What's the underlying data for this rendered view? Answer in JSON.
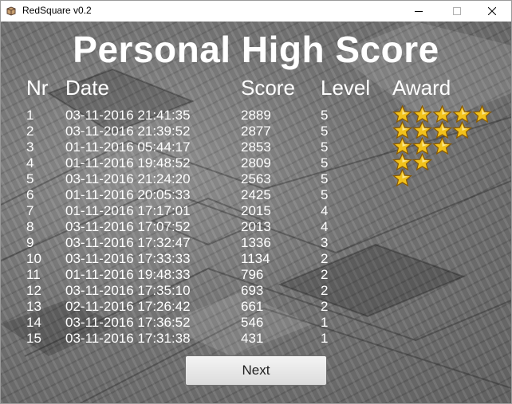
{
  "window": {
    "title": "RedSquare v0.2",
    "icon": "cube-icon"
  },
  "page_title": "Personal High Score",
  "columns": {
    "nr": "Nr",
    "date": "Date",
    "score": "Score",
    "level": "Level",
    "award": "Award"
  },
  "rows": [
    {
      "nr": "1",
      "date": "03-11-2016 21:41:35",
      "score": "2889",
      "level": "5",
      "stars": 5
    },
    {
      "nr": "2",
      "date": "03-11-2016 21:39:52",
      "score": "2877",
      "level": "5",
      "stars": 4
    },
    {
      "nr": "3",
      "date": "01-11-2016 05:44:17",
      "score": "2853",
      "level": "5",
      "stars": 3
    },
    {
      "nr": "4",
      "date": "01-11-2016 19:48:52",
      "score": "2809",
      "level": "5",
      "stars": 2
    },
    {
      "nr": "5",
      "date": "03-11-2016 21:24:20",
      "score": "2563",
      "level": "5",
      "stars": 1
    },
    {
      "nr": "6",
      "date": "01-11-2016 20:05:33",
      "score": "2425",
      "level": "5",
      "stars": 0
    },
    {
      "nr": "7",
      "date": "01-11-2016 17:17:01",
      "score": "2015",
      "level": "4",
      "stars": 0
    },
    {
      "nr": "8",
      "date": "03-11-2016 17:07:52",
      "score": "2013",
      "level": "4",
      "stars": 0
    },
    {
      "nr": "9",
      "date": "03-11-2016 17:32:47",
      "score": "1336",
      "level": "3",
      "stars": 0
    },
    {
      "nr": "10",
      "date": "03-11-2016 17:33:33",
      "score": "1134",
      "level": "2",
      "stars": 0
    },
    {
      "nr": "11",
      "date": "01-11-2016 19:48:33",
      "score": "796",
      "level": "2",
      "stars": 0
    },
    {
      "nr": "12",
      "date": "03-11-2016 17:35:10",
      "score": "693",
      "level": "2",
      "stars": 0
    },
    {
      "nr": "13",
      "date": "02-11-2016 17:26:42",
      "score": "661",
      "level": "2",
      "stars": 0
    },
    {
      "nr": "14",
      "date": "03-11-2016 17:36:52",
      "score": "546",
      "level": "1",
      "stars": 0
    },
    {
      "nr": "15",
      "date": "03-11-2016 17:31:38",
      "score": "431",
      "level": "1",
      "stars": 0
    }
  ],
  "next_button": "Next",
  "colors": {
    "text": "#ffffff",
    "star_fill": "#f2c21b",
    "star_stroke": "#8a5a00"
  }
}
